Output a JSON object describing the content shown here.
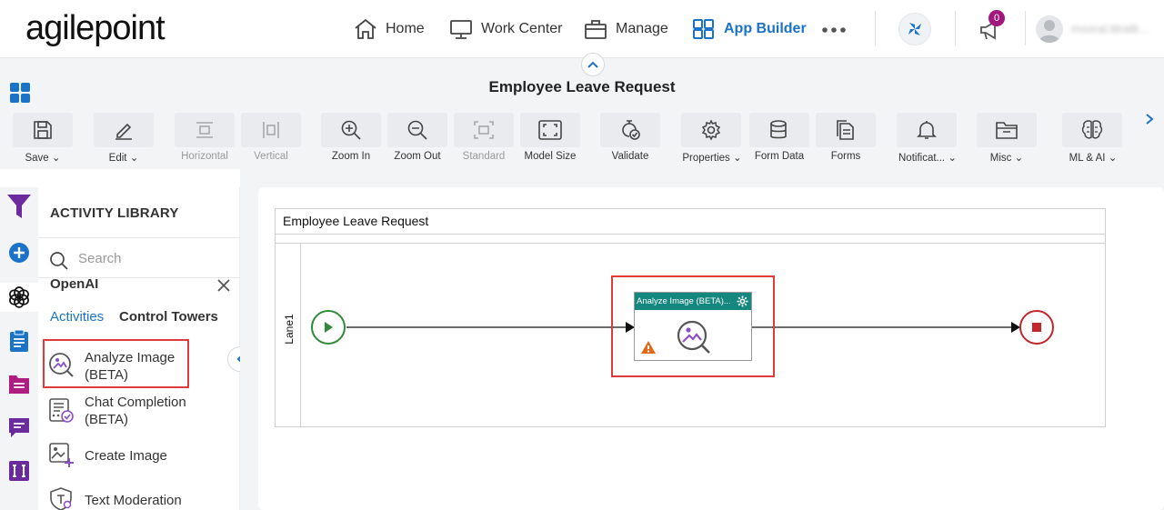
{
  "brand": {
    "logo_text": "agilepoint"
  },
  "nav": {
    "home": "Home",
    "work_center": "Work Center",
    "manage": "Manage",
    "app_builder": "App Builder",
    "notification_count": "0",
    "user_name": "msoral.titratk..."
  },
  "header": {
    "title": "Employee Leave Request"
  },
  "toolbar": {
    "save": "Save",
    "edit": "Edit",
    "horizontal": "Horizontal",
    "vertical": "Vertical",
    "zoom_in": "Zoom In",
    "zoom_out": "Zoom Out",
    "standard": "Standard",
    "model_size": "Model Size",
    "validate": "Validate",
    "properties": "Properties",
    "form_data": "Form Data",
    "forms": "Forms",
    "notifications": "Notificat...",
    "misc": "Misc",
    "ml_ai": "ML & AI"
  },
  "library": {
    "title": "ACTIVITY LIBRARY",
    "search_placeholder": "Search",
    "category": "OpenAI",
    "tabs": [
      "Activities",
      "Control Towers"
    ],
    "activities": [
      {
        "line1": "Analyze Image",
        "line2": "(BETA)"
      },
      {
        "line1": "Chat Completion",
        "line2": "(BETA)"
      },
      {
        "line1": "Create Image",
        "line2": ""
      },
      {
        "line1": "Text Moderation",
        "line2": ""
      }
    ]
  },
  "canvas": {
    "pool_title": "Employee Leave Request",
    "lane": "Lane1",
    "activity_title": "Analyze Image (BETA)..."
  },
  "colors": {
    "accent": "#1a73c8",
    "teal": "#14877f",
    "highlight": "#e03a3a",
    "start": "#2e8b3a",
    "end": "#c0262c",
    "badge": "#a0177f"
  }
}
